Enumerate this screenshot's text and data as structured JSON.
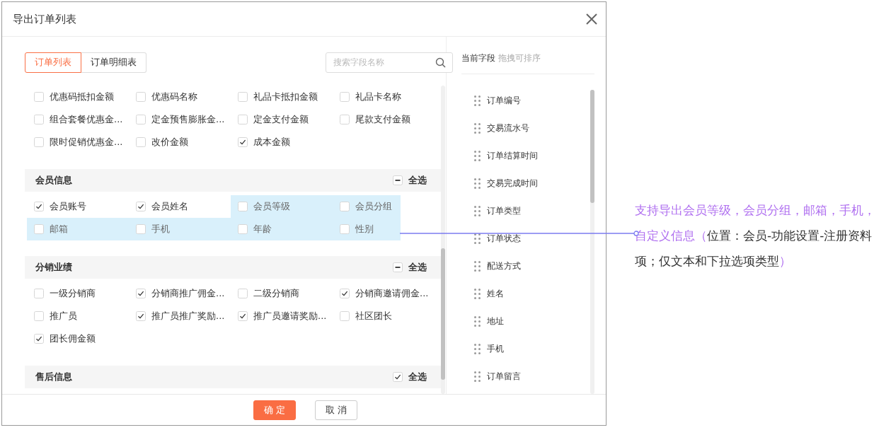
{
  "dialog": {
    "title": "导出订单列表"
  },
  "tabs": [
    {
      "label": "订单列表",
      "selected": true
    },
    {
      "label": "订单明细表",
      "selected": false
    }
  ],
  "search": {
    "placeholder": "搜索字段名称"
  },
  "field_groups": [
    {
      "items": [
        {
          "label": "优惠码抵扣金额",
          "checked": false,
          "highlighted": false
        },
        {
          "label": "优惠码名称",
          "checked": false,
          "highlighted": false
        },
        {
          "label": "礼品卡抵扣金额",
          "checked": false,
          "highlighted": false
        },
        {
          "label": "礼品卡名称",
          "checked": false,
          "highlighted": false
        },
        {
          "label": "组合套餐优惠金...",
          "checked": false,
          "highlighted": false
        },
        {
          "label": "定金预售膨胀金...",
          "checked": false,
          "highlighted": false
        },
        {
          "label": "定金支付金额",
          "checked": false,
          "highlighted": false
        },
        {
          "label": "尾款支付金额",
          "checked": false,
          "highlighted": false
        },
        {
          "label": "限时促销优惠金...",
          "checked": false,
          "highlighted": false
        },
        {
          "label": "改价金额",
          "checked": false,
          "highlighted": false
        },
        {
          "label": "成本金额",
          "checked": true,
          "highlighted": false
        }
      ]
    },
    {
      "title": "会员信息",
      "select_all": {
        "label": "全选",
        "checked": false,
        "indeterminate": true
      },
      "items": [
        {
          "label": "会员账号",
          "checked": true,
          "highlighted": false
        },
        {
          "label": "会员姓名",
          "checked": true,
          "highlighted": false
        },
        {
          "label": "会员等级",
          "checked": false,
          "highlighted": true
        },
        {
          "label": "会员分组",
          "checked": false,
          "highlighted": true
        },
        {
          "label": "邮箱",
          "checked": false,
          "highlighted": true
        },
        {
          "label": "手机",
          "checked": false,
          "highlighted": true
        },
        {
          "label": "年龄",
          "checked": false,
          "highlighted": true
        },
        {
          "label": "性别",
          "checked": false,
          "highlighted": true
        }
      ]
    },
    {
      "title": "分销业绩",
      "select_all": {
        "label": "全选",
        "checked": false,
        "indeterminate": true
      },
      "items": [
        {
          "label": "一级分销商",
          "checked": false,
          "highlighted": false
        },
        {
          "label": "分销商推广佣金...",
          "checked": true,
          "highlighted": false
        },
        {
          "label": "二级分销商",
          "checked": false,
          "highlighted": false
        },
        {
          "label": "分销商邀请佣金...",
          "checked": true,
          "highlighted": false
        },
        {
          "label": "推广员",
          "checked": false,
          "highlighted": false
        },
        {
          "label": "推广员推广奖励...",
          "checked": true,
          "highlighted": false
        },
        {
          "label": "推广员邀请奖励...",
          "checked": true,
          "highlighted": false
        },
        {
          "label": "社区团长",
          "checked": false,
          "highlighted": false
        },
        {
          "label": "团长佣金额",
          "checked": true,
          "highlighted": false
        }
      ]
    },
    {
      "title": "售后信息",
      "select_all": {
        "label": "全选",
        "checked": true,
        "indeterminate": false
      }
    }
  ],
  "current_fields": {
    "title": "当前字段",
    "hint": "拖拽可排序",
    "items": [
      "订单编号",
      "交易流水号",
      "订单结算时间",
      "交易完成时间",
      "订单类型",
      "订单状态",
      "配送方式",
      "姓名",
      "地址",
      "手机",
      "订单留言"
    ]
  },
  "buttons": [
    {
      "label": "确 定",
      "kind": "primary"
    },
    {
      "label": "取 消",
      "kind": "default"
    }
  ],
  "annotation": {
    "lines": [
      {
        "segments": [
          {
            "text": "支持导出会员等级，会员分组，邮箱，手机，",
            "emphasis": true
          }
        ]
      },
      {
        "segments": [
          {
            "text": "自定义信息（",
            "emphasis": true
          },
          {
            "text": "位置：会员-功能设置-注册资料",
            "emphasis": false
          }
        ]
      },
      {
        "segments": [
          {
            "text": "项；仅文本和下拉选项类型",
            "emphasis": false
          },
          {
            "text": "）",
            "emphasis": true
          }
        ]
      }
    ]
  }
}
